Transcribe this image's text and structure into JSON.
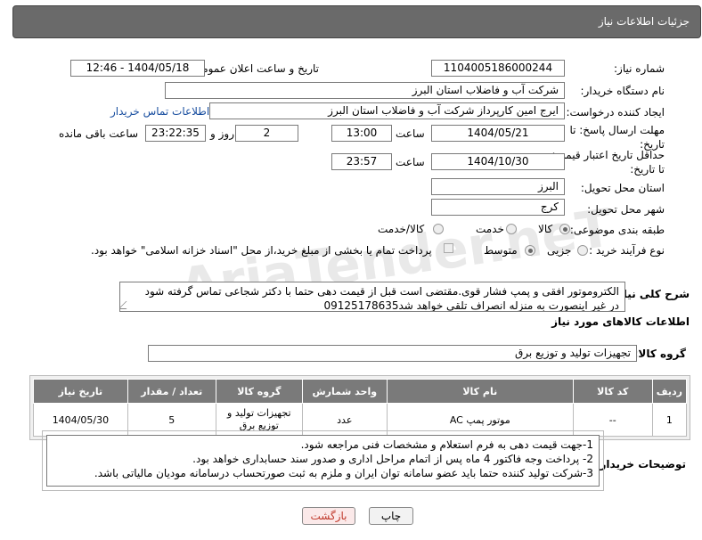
{
  "header": {
    "title": "جزئیات اطلاعات نیاز"
  },
  "fields": {
    "need_number_label": "شماره نیاز:",
    "need_number_value": "1104005186000244",
    "announce_label": "تاریخ و ساعت اعلان عمومی:",
    "announce_value": "1404/05/18 - 12:46",
    "buyer_org_label": "نام دستگاه خریدار:",
    "buyer_org_value": "شرکت آب و فاضلاب استان البرز",
    "creator_label": "ایجاد کننده درخواست:",
    "creator_value": "ایرج امین کارپرداز شرکت آب و فاضلاب استان البرز",
    "buyer_contact_link": "اطلاعات تماس خریدار",
    "deadline_label": "مهلت ارسال پاسخ: تا تاریخ:",
    "deadline_date": "1404/05/21",
    "time_label": "ساعت",
    "deadline_time": "13:00",
    "days_value": "2",
    "days_label": "روز و",
    "remaining_value": "23:22:35",
    "remaining_label": "ساعت باقی مانده",
    "validity_label": "حداقل تاریخ اعتبار قیمت: تا تاریخ:",
    "validity_date": "1404/10/30",
    "validity_time_label": "ساعت",
    "validity_time": "23:57",
    "province_label": "استان محل تحویل:",
    "province_value": "البرز",
    "city_label": "شهر محل تحویل:",
    "city_value": "کرج",
    "category_label": "طبقه بندی موضوعی:",
    "category_options": [
      "کالا",
      "خدمت",
      "کالا/خدمت"
    ],
    "category_selected": "کالا",
    "process_label": "نوع فرآیند خرید :",
    "process_options": [
      "جزیی",
      "متوسط"
    ],
    "process_selected": "متوسط",
    "payment_note": "پرداخت تمام یا بخشی از مبلغ خرید،از محل \"اسناد خزانه اسلامی\" خواهد بود."
  },
  "description": {
    "label": "شرح کلی نیاز:",
    "line1": "الکتروموتور افقی و پمپ فشار قوی.مقتضی است قبل از قیمت دهی حتما با دکتر شجاعی تماس گرفته شود",
    "line2": "در غیر اینصورت به منزله انصراف تلقی خواهد شد09125178635"
  },
  "goods": {
    "section_title": "اطلاعات کالاهای مورد نیاز",
    "group_label": "گروه کالا:",
    "group_value": "تجهیزات تولید و توزیع برق",
    "columns": [
      "ردیف",
      "کد کالا",
      "نام کالا",
      "واحد شمارش",
      "گروه کالا",
      "تعداد / مقدار",
      "تاریخ نیاز"
    ],
    "rows": [
      {
        "index": "1",
        "code": "--",
        "name": "موتور پمپ AC",
        "unit": "عدد",
        "group": "تجهیزات تولید و توزیع برق",
        "qty": "5",
        "date": "1404/05/30"
      }
    ]
  },
  "buyer_notes": {
    "label": "توضیحات خریدار:",
    "line1": "1-جهت قیمت دهی به فرم استعلام و مشخصات فنی مراجعه شود.",
    "line2": "2- پرداخت وجه فاکتور 4 ماه پس از اتمام مراحل اداری و صدور سند حسابداری خواهد بود.",
    "line3": "3-شرکت تولید کننده حتما باید عضو سامانه توان ایران و ملزم به ثبت صورتحساب درسامانه مودیان مالیاتی باشد."
  },
  "buttons": {
    "print": "چاپ",
    "back": "بازگشت"
  },
  "watermark": {
    "text": "AriaTender.neT"
  },
  "colors": {
    "header_bg": "#6a6a6a",
    "table_header_bg": "#7a7a7a",
    "link": "#1a4fa0",
    "back_button_text": "#c0392b"
  }
}
